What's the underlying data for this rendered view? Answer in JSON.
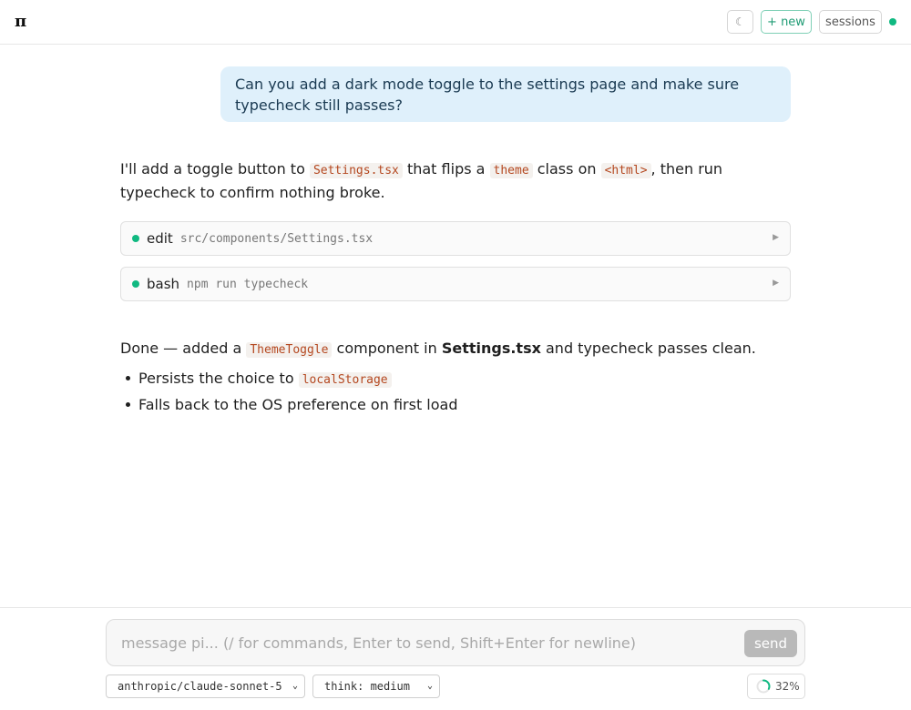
{
  "header": {
    "logo": "π",
    "theme_toggle_icon": "☾",
    "new_label": "+ new",
    "sessions_label": "sessions",
    "status_color": "#10b981"
  },
  "conversation": {
    "user_message": "Can you add a dark mode toggle to the settings page and make sure typecheck still passes?",
    "assistant_intro": {
      "t1": "I'll add a toggle button to ",
      "c1": "Settings.tsx",
      "t2": " that flips a ",
      "c2": "theme",
      "t3": " class on ",
      "c3": "<html>",
      "t4": ", then run typecheck to confirm nothing broke."
    },
    "tools": [
      {
        "name": "edit",
        "arg": "src/components/Settings.tsx",
        "status": "success"
      },
      {
        "name": "bash",
        "arg": "npm run typecheck",
        "status": "success"
      }
    ],
    "assistant_done": {
      "t1": "Done — added a ",
      "c1": "ThemeToggle",
      "t2": " component in ",
      "b1": "Settings.tsx",
      "t3": " and typecheck passes clean."
    },
    "bullets": [
      {
        "text": "Persists the choice to ",
        "code": "localStorage"
      },
      {
        "text": "Falls back to the OS preference on first load",
        "code": ""
      }
    ]
  },
  "composer": {
    "placeholder": "message pi... (/ for commands, Enter to send, Shift+Enter for newline)",
    "value": "",
    "send_label": "send"
  },
  "footer": {
    "model": "anthropic/claude-sonnet-5",
    "thinking": "think: medium",
    "context_percent": 32,
    "context_label": "32%"
  }
}
